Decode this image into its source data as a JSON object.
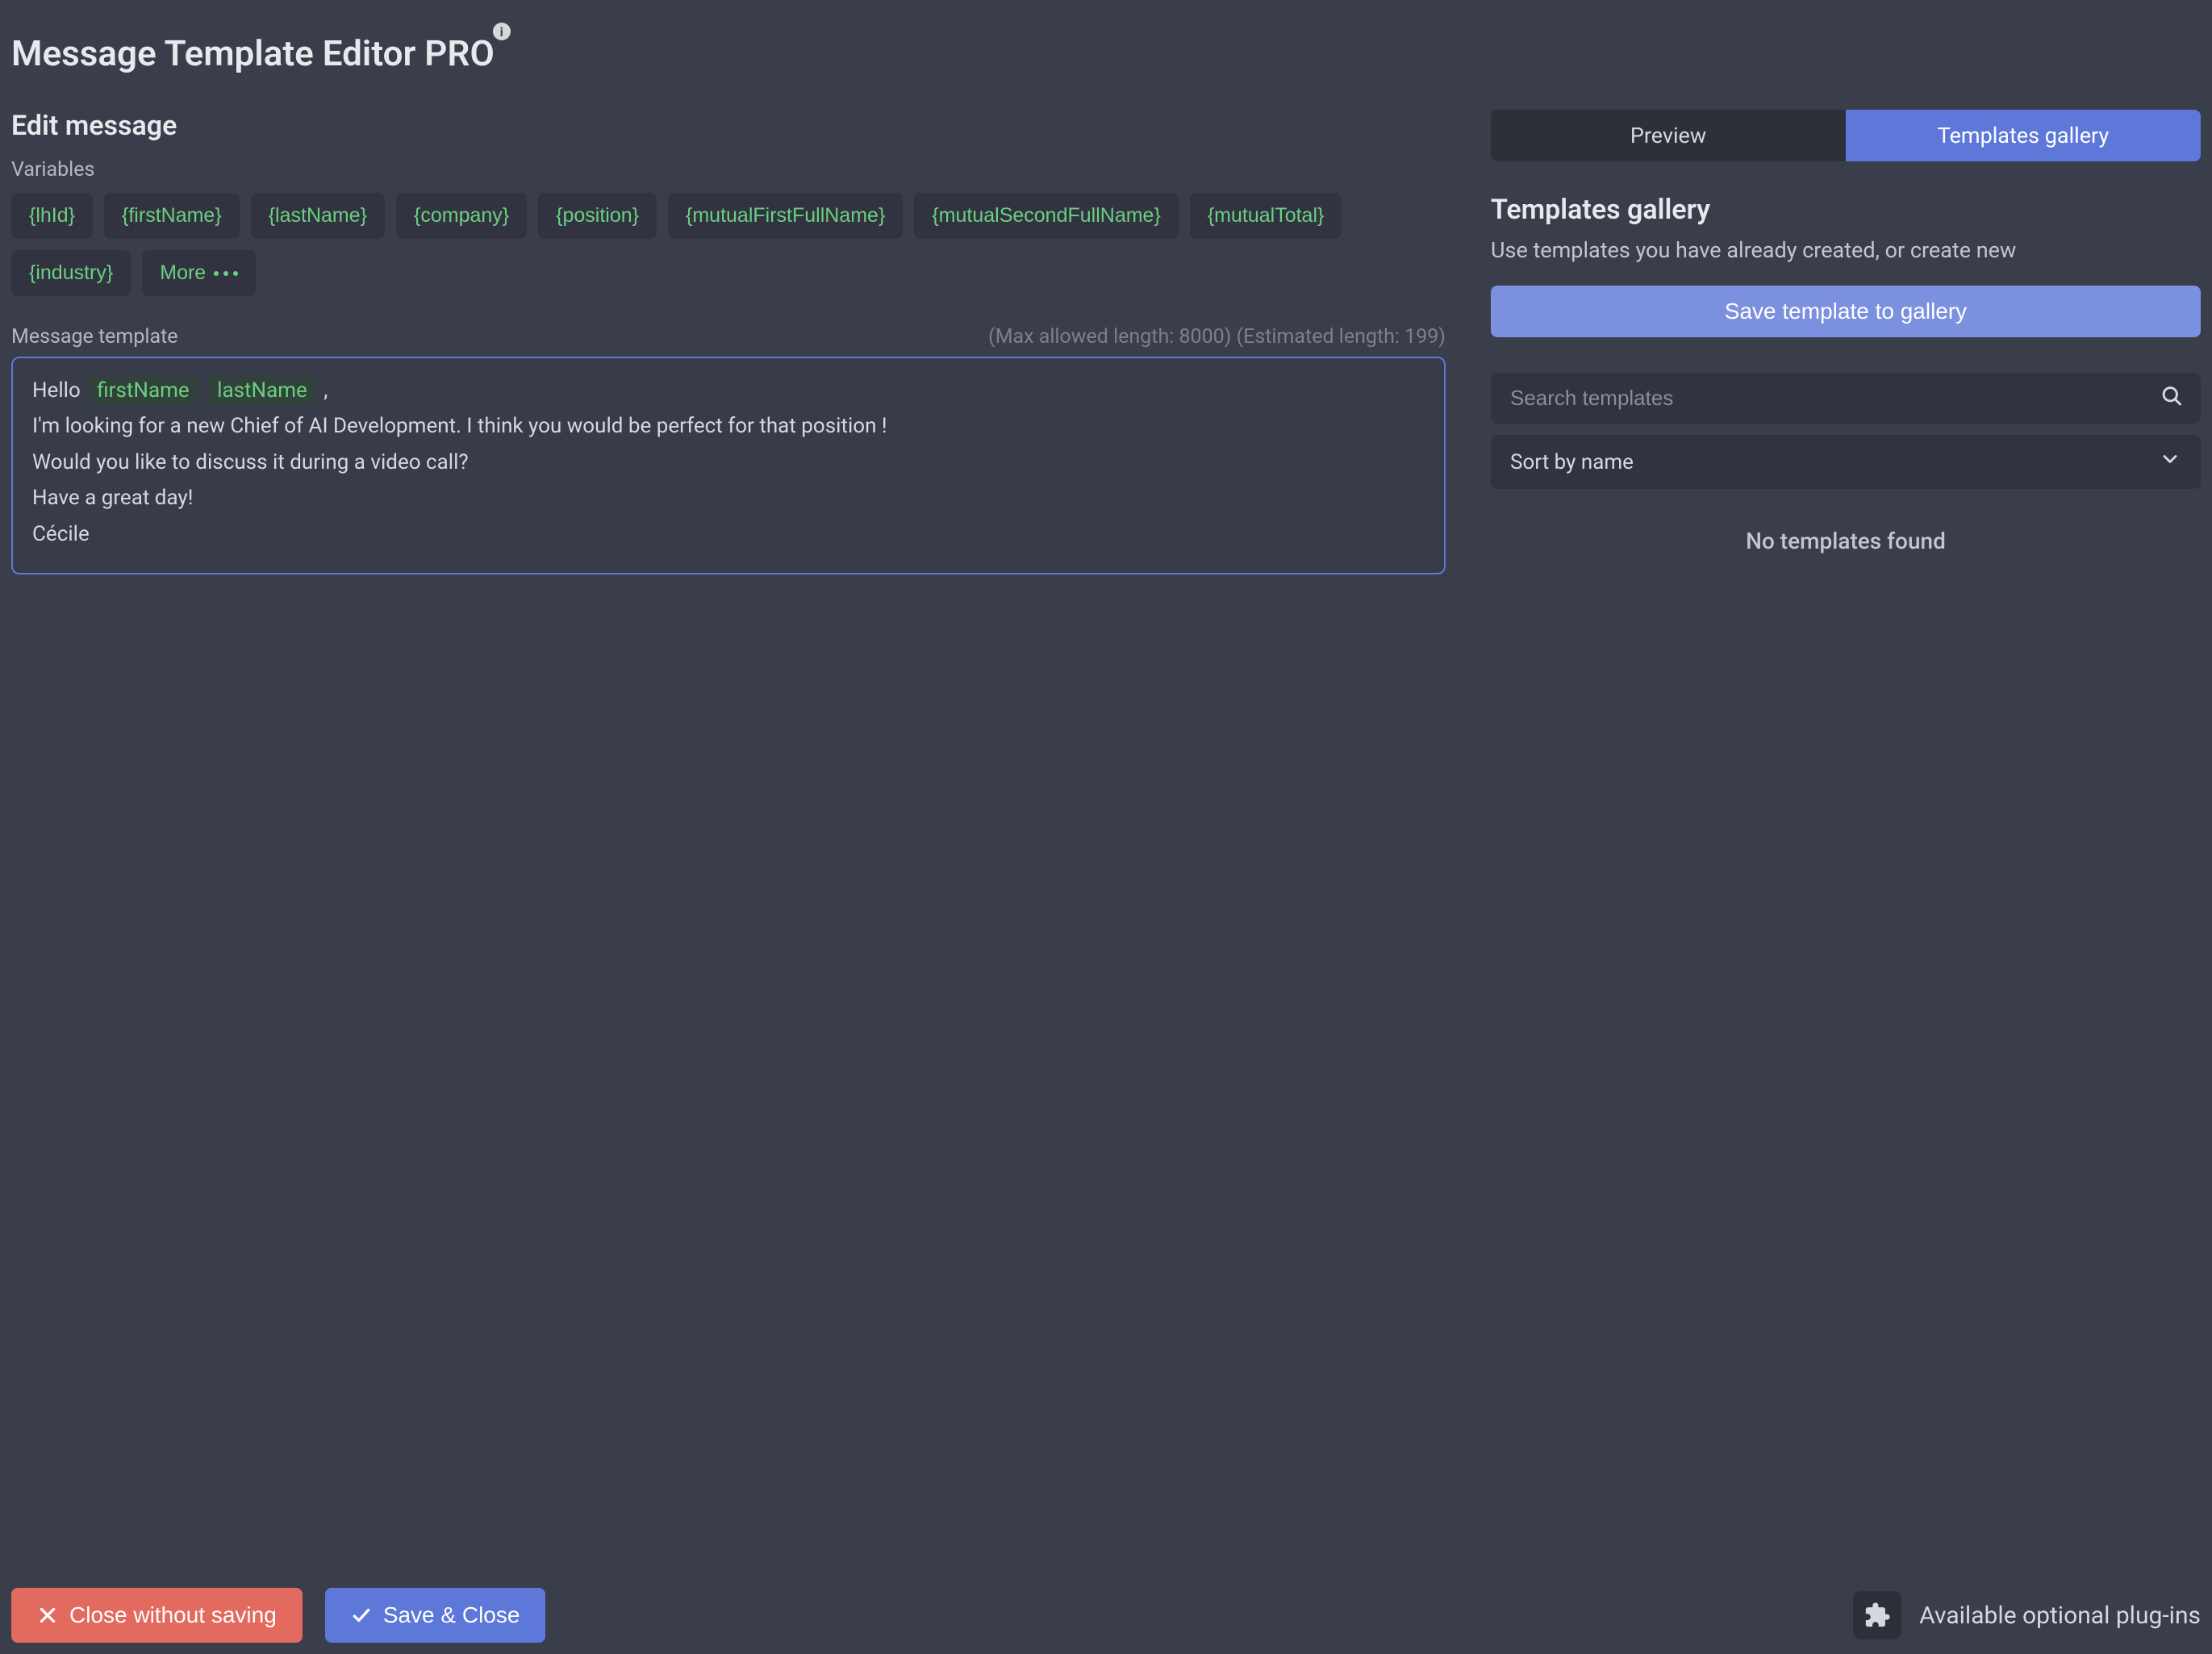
{
  "app": {
    "title": "Message Template Editor PRO"
  },
  "editor": {
    "section_title": "Edit message",
    "variables_label": "Variables",
    "variables": [
      "{lhId}",
      "{firstName}",
      "{lastName}",
      "{company}",
      "{position}",
      "{mutualFirstFullName}",
      "{mutualSecondFullName}",
      "{mutualTotal}",
      "{industry}"
    ],
    "more_label": "More",
    "template_label": "Message template",
    "max_length_text": "(Max allowed length: 8000) (Estimated length: 199)",
    "content": {
      "line1_prefix": "Hello",
      "line1_var1": "firstName",
      "line1_var2": "lastName",
      "line1_suffix": ",",
      "line2": "I'm looking for a new Chief of AI Development. I think you would be perfect for that position !",
      "line3": "Would you like to discuss it during a video call?",
      "line4": "Have a great day!",
      "line5": "Cécile"
    }
  },
  "tabs": {
    "preview": "Preview",
    "gallery": "Templates gallery"
  },
  "gallery": {
    "title": "Templates gallery",
    "desc": "Use templates you have already created, or create new",
    "save_btn": "Save template to gallery",
    "search_placeholder": "Search templates",
    "sort_label": "Sort by name",
    "empty": "No templates found"
  },
  "footer": {
    "close_label": "Close without saving",
    "save_label": "Save & Close",
    "plugins_label": "Available optional plug-ins"
  }
}
